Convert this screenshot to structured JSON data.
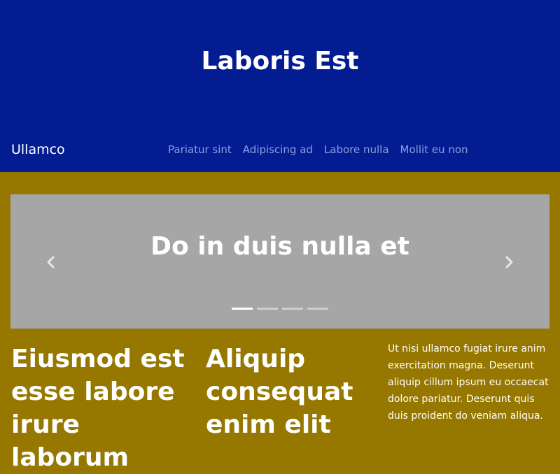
{
  "header": {
    "site_title": "Laboris Est",
    "brand": "Ullamco",
    "nav": [
      "Pariatur sint",
      "Adipiscing ad",
      "Labore nulla",
      "Mollit eu non"
    ]
  },
  "carousel": {
    "caption": "Do in duis nulla et",
    "prev_icon": "chevron-left-icon",
    "next_icon": "chevron-right-icon",
    "slide_count": 4,
    "active_index": 0
  },
  "columns": [
    {
      "heading": "Eiusmod est esse labore irure laborum"
    },
    {
      "heading": "Aliquip consequat enim elit"
    },
    {
      "text": "Ut nisi ullamco fugiat irure anim exercitation magna. Deserunt aliquip cillum ipsum eu occaecat dolore pariatur. Deserunt quis duis proident do veniam aliqua."
    }
  ],
  "colors": {
    "header_bg": "#031c92",
    "body_bg": "#967800",
    "carousel_bg": "#a6a6a6",
    "nav_link": "#8f9fdb"
  }
}
